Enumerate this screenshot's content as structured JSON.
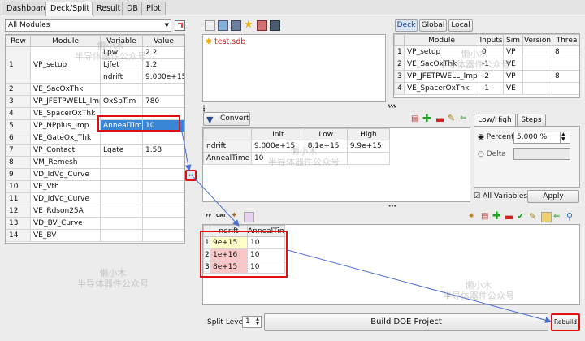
{
  "tabs": [
    "Dashboard",
    "Deck/Split",
    "Result",
    "DB",
    "Plot"
  ],
  "module_select": "All Modules",
  "modules_table": {
    "headers": [
      "Row",
      "Module",
      "Variable",
      "Value"
    ],
    "rows": [
      {
        "row": "1",
        "module": "VP_setup",
        "vars": [
          [
            "Lpw",
            "2.2"
          ],
          [
            "Ljfet",
            "1.2"
          ],
          [
            "ndrift",
            "9.000e+15"
          ]
        ]
      },
      {
        "row": "2",
        "module": "VE_SacOxThk",
        "var": "",
        "value": ""
      },
      {
        "row": "3",
        "module": "VP_JFETPWELL_Imp",
        "var": "OxSpTim",
        "value": "780"
      },
      {
        "row": "4",
        "module": "VE_SpacerOxThk",
        "var": "",
        "value": ""
      },
      {
        "row": "5",
        "module": "VP_NPplus_Imp",
        "var": "AnnealTime",
        "value": "10"
      },
      {
        "row": "6",
        "module": "VE_GateOx_Thk",
        "var": "",
        "value": ""
      },
      {
        "row": "7",
        "module": "VP_Contact",
        "var": "Lgate",
        "value": "1.58"
      },
      {
        "row": "8",
        "module": "VM_Remesh",
        "var": "",
        "value": ""
      },
      {
        "row": "9",
        "module": "VD_IdVg_Curve",
        "var": "",
        "value": ""
      },
      {
        "row": "10",
        "module": "VE_Vth",
        "var": "",
        "value": ""
      },
      {
        "row": "11",
        "module": "VD_IdVd_Curve",
        "var": "",
        "value": ""
      },
      {
        "row": "12",
        "module": "VE_Rdson25A",
        "var": "",
        "value": ""
      },
      {
        "row": "13",
        "module": "VD_BV_Curve",
        "var": "",
        "value": ""
      },
      {
        "row": "14",
        "module": "VE_BV",
        "var": "",
        "value": ""
      }
    ]
  },
  "file_item": "test.sdb",
  "deck_tabs": [
    "Deck",
    "Global",
    "Local"
  ],
  "deck_table": {
    "headers": [
      "",
      "Module",
      "Inputs",
      "Sim",
      "Version",
      "Threa"
    ],
    "rows": [
      [
        "1",
        "VP_setup",
        "0",
        "VP",
        "",
        "8"
      ],
      [
        "2",
        "VE_SacOxThk",
        "-1",
        "VE",
        "",
        ""
      ],
      [
        "3",
        "VP_JFETPWELL_Imp",
        "-2",
        "VP",
        "",
        "8"
      ],
      [
        "4",
        "VE_SpacerOxThk",
        "-1",
        "VE",
        "",
        ""
      ]
    ]
  },
  "convert_label": "Convert",
  "split_table": {
    "headers": [
      "",
      "Init",
      "Low",
      "High"
    ],
    "rows": [
      [
        "ndrift",
        "9.000e+15",
        "8.1e+15",
        "9.9e+15"
      ],
      [
        "AnnealTime",
        "10",
        "",
        ""
      ]
    ]
  },
  "lowhigh_tabs": [
    "Low/High",
    "Steps"
  ],
  "percent_label": "Percent",
  "percent_value": "5.000 %",
  "delta_label": "Delta",
  "all_vars_label": "All Variables",
  "apply_label": "Apply",
  "toolbar_small": [
    "FF",
    "OAT"
  ],
  "doe_table": {
    "headers": [
      "",
      "ndrift",
      "AnnealTime"
    ],
    "rows": [
      [
        "1",
        "9e+15",
        "10"
      ],
      [
        "2",
        "1e+16",
        "10"
      ],
      [
        "3",
        "8e+15",
        "10"
      ]
    ]
  },
  "split_level_label": "Split Level",
  "split_level_value": "1",
  "build_doe_label": "Build DOE Project",
  "rebuild_label": "Rebuild",
  "watermark": [
    "懒小木",
    "半导体器件公众号"
  ],
  "colors": {
    "highlight_blue": "#3a86d6",
    "red_frame": "#e01010",
    "doe_yellow": "#ffffc8",
    "doe_pink": "#f8c8c8",
    "arrow": "#4b6fd0"
  }
}
